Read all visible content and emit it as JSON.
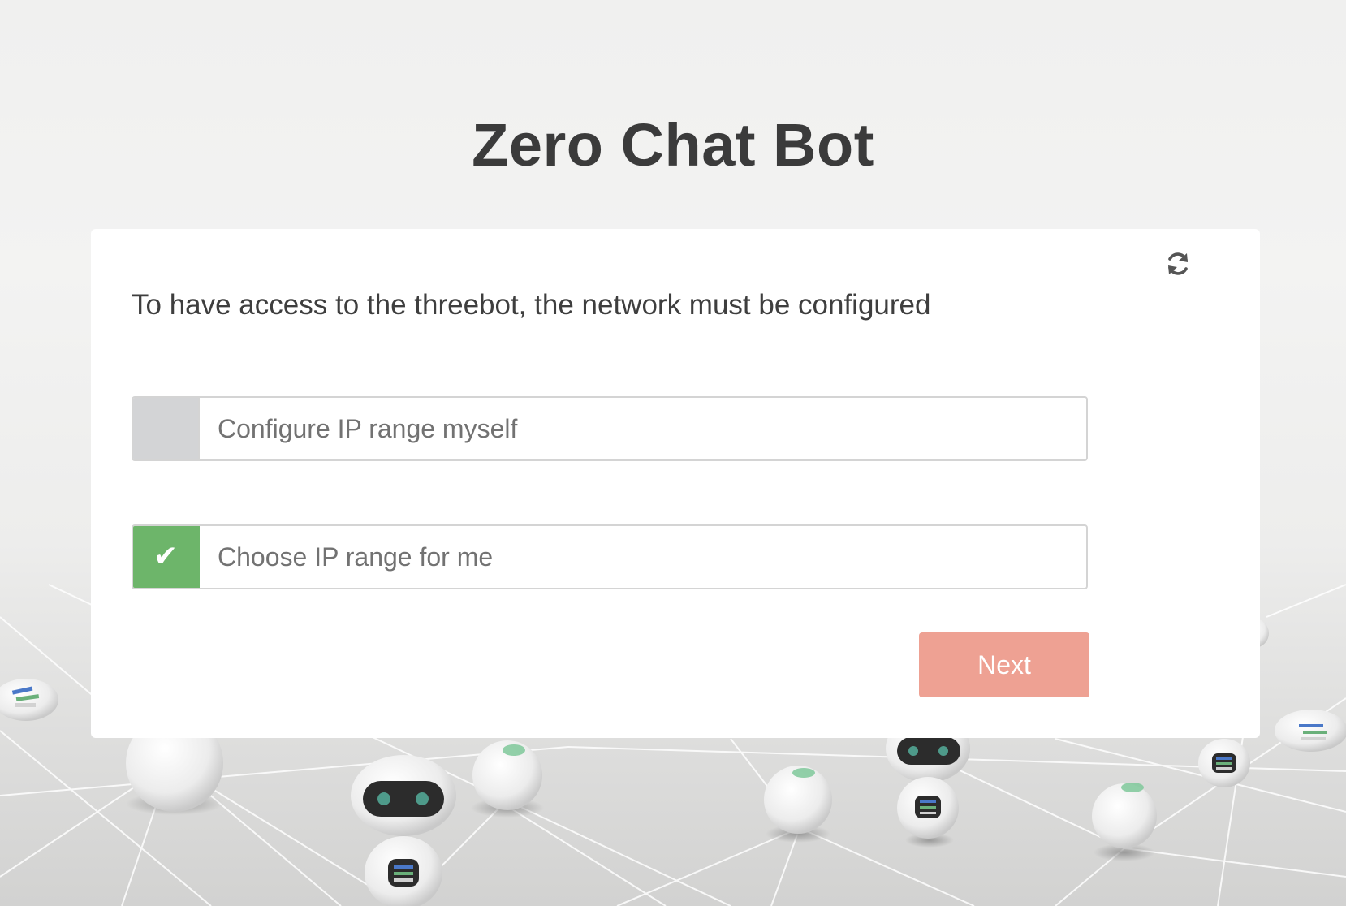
{
  "header": {
    "title": "Zero Chat Bot"
  },
  "card": {
    "message": "To have access to the threebot, the network must be configured",
    "refresh_icon": "refresh-icon",
    "options": [
      {
        "label": "Configure IP range myself",
        "checked": false
      },
      {
        "label": "Choose IP range for me",
        "checked": true
      }
    ],
    "check_glyph": "✔",
    "next_label": "Next"
  },
  "colors": {
    "title_text": "#3b3b3b",
    "checked": "#6db56a",
    "unchecked": "#d3d4d6",
    "next_button": "#eea193"
  }
}
